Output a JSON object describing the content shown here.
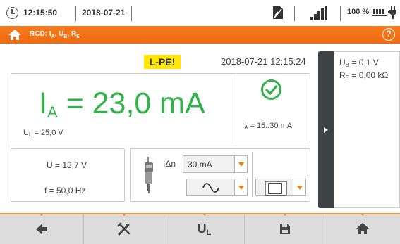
{
  "status_bar": {
    "time": "12:15:50",
    "date": "2018-07-21",
    "battery_percent": "100 %",
    "icons": [
      "clock-icon",
      "sd-card-icon",
      "signal-icon",
      "battery-icon",
      "plug-icon"
    ]
  },
  "title_bar": {
    "title_main": "RCD: I",
    "title_sub_a": "A",
    "title_sep_1": ", U",
    "title_sub_b": "B",
    "title_sep_2": ", R",
    "title_sub_e": "E",
    "help_label": "?",
    "accent_color": "#f47b1e"
  },
  "measurement": {
    "mode_badge": "L-PE!",
    "datetime": "2018-07-21 12:15:24",
    "main_symbol": "I",
    "main_sub": "A",
    "main_value": " = 23,0 mA",
    "main_color": "#33b24a",
    "ul_symbol": "U",
    "ul_sub": "L",
    "ul_value": " = 25,0 V",
    "range_symbol": "I",
    "range_sub": "A",
    "range_value": " = 15..30 mA",
    "status_icon": "check-circle-icon",
    "voltage": "U = 18,7 V",
    "frequency": "f = 50,0 Hz"
  },
  "settings": {
    "idn_label": "IΔn",
    "idn_value": "30 mA",
    "waveform": "sine-wave-icon",
    "pulse": "square-wave-icon"
  },
  "side_panel": {
    "ub_symbol": "U",
    "ub_sub": "B",
    "ub_value": " = 0,1 V",
    "re_symbol": "R",
    "re_sub": "E",
    "re_value": " = 0,00 kΩ"
  },
  "toolbar": {
    "buttons": [
      "back-arrow-icon",
      "settings-tools-icon",
      "ul-button",
      "save-icon",
      "home-icon"
    ],
    "ul_symbol": "U",
    "ul_sub": "L"
  }
}
